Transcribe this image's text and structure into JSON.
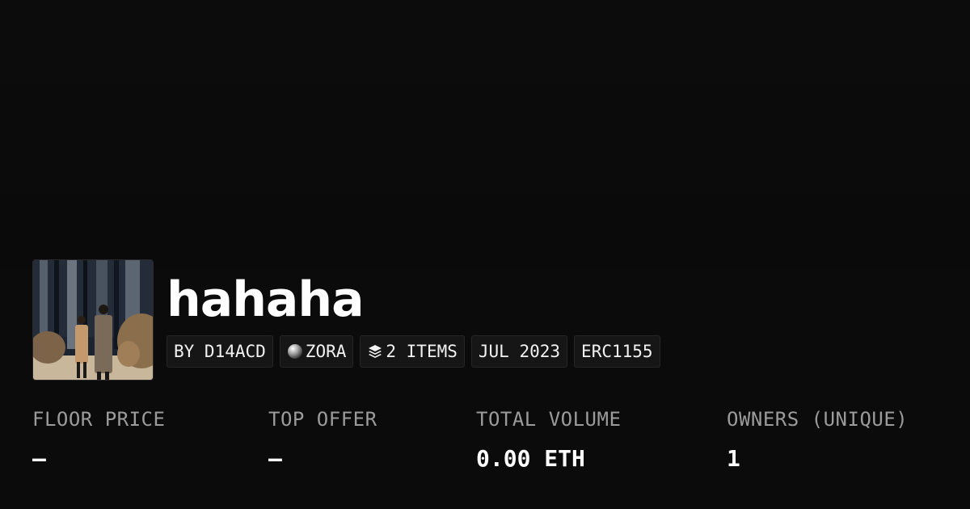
{
  "collection": {
    "name": "hahaha",
    "thumbnail_icon": "collection-thumbnail-image"
  },
  "chips": {
    "creator": "BY D14ACD",
    "chain": "ZORA",
    "chain_icon": "zora-orb-icon",
    "items": "2 ITEMS",
    "items_icon": "layers-icon",
    "date": "JUL 2023",
    "standard": "ERC1155"
  },
  "stats": {
    "floor_price": {
      "label": "FLOOR PRICE",
      "value": "–"
    },
    "top_offer": {
      "label": "TOP OFFER",
      "value": "–"
    },
    "total_volume": {
      "label": "TOTAL VOLUME",
      "value": "0.00 ETH"
    },
    "owners": {
      "label": "OWNERS (UNIQUE)",
      "value": "1"
    }
  },
  "colors": {
    "background": "#0b0b0b",
    "chip_background": "#161616",
    "label_gray": "#9b9b9b"
  }
}
